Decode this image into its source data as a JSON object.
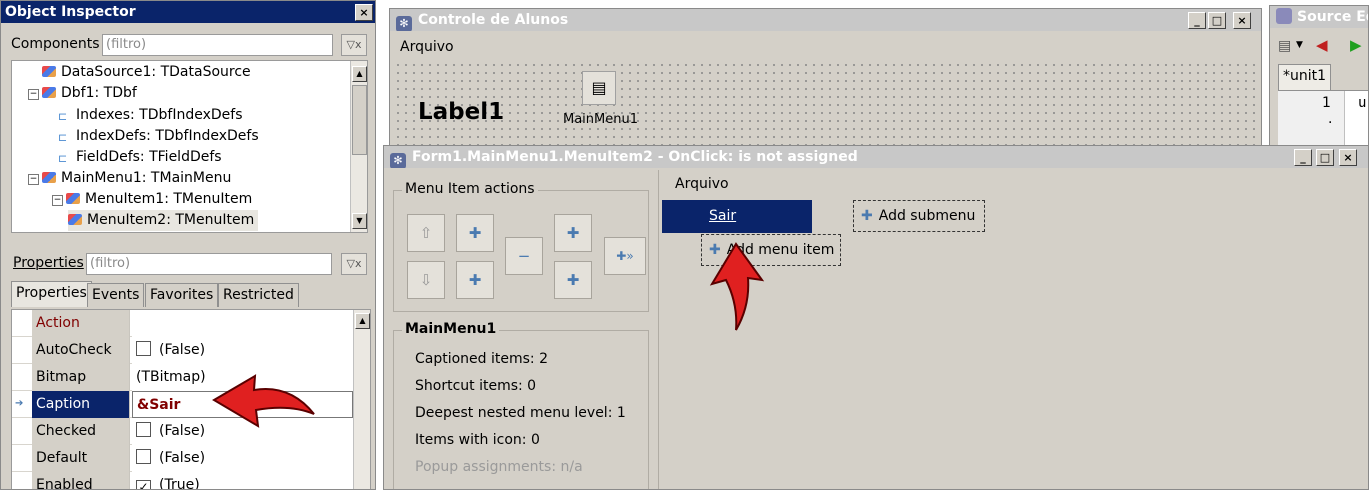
{
  "object_inspector": {
    "title": "Object Inspector",
    "components_label": "Components",
    "components_filter_placeholder": "(filtro)",
    "tree": [
      {
        "label": "DataSource1: TDataSource"
      },
      {
        "label": "Dbf1: TDbf",
        "expander": "−"
      },
      {
        "label": "Indexes: TDbfIndexDefs"
      },
      {
        "label": "IndexDefs: TDbfIndexDefs"
      },
      {
        "label": "FieldDefs: TFieldDefs"
      },
      {
        "label": "MainMenu1: TMainMenu",
        "expander": "−"
      },
      {
        "label": "MenuItem1: TMenuItem",
        "expander": "−"
      },
      {
        "label": "MenuItem2: TMenuItem"
      }
    ],
    "properties_label": "Properties",
    "properties_filter_placeholder": "(filtro)",
    "tabs": [
      "Properties",
      "Events",
      "Favorites",
      "Restricted"
    ],
    "properties": [
      {
        "name": "Action",
        "value": ""
      },
      {
        "name": "AutoCheck",
        "value": "(False)",
        "checked": false
      },
      {
        "name": "Bitmap",
        "value": "(TBitmap)"
      },
      {
        "name": "Caption",
        "value": "&Sair"
      },
      {
        "name": "Checked",
        "value": "(False)",
        "checked": false
      },
      {
        "name": "Default",
        "value": "(False)",
        "checked": false
      },
      {
        "name": "Enabled",
        "value": "(True)",
        "checked": true,
        "mark": "✓"
      }
    ]
  },
  "form_window": {
    "title": "Controle de Alunos",
    "menu": "Arquivo",
    "label1": "Label1",
    "component_caption": "MainMenu1"
  },
  "source_editor": {
    "title": "Source Ed",
    "tab": "*unit1",
    "line_number": "1",
    "line_text": "u"
  },
  "menu_editor": {
    "title": "Form1.MainMenu1.MenuItem2 - OnClick: is not assigned",
    "actions_legend": "Menu Item actions",
    "info_legend": "MainMenu1",
    "info": [
      "Captioned items: 2",
      "Shortcut items: 0",
      "Deepest nested menu level: 1",
      "Items with icon: 0",
      "Popup assignments: n/a"
    ],
    "preview_menu": "Arquivo",
    "selected_item": "Sair",
    "add_submenu": "Add submenu",
    "add_menu_item": "Add menu item"
  },
  "window_buttons": {
    "minimize": "_",
    "maximize": "□",
    "close": "×"
  },
  "colors": {
    "selection": "#0a246a",
    "caption_value": "#800000",
    "arrow": "#e02020"
  }
}
